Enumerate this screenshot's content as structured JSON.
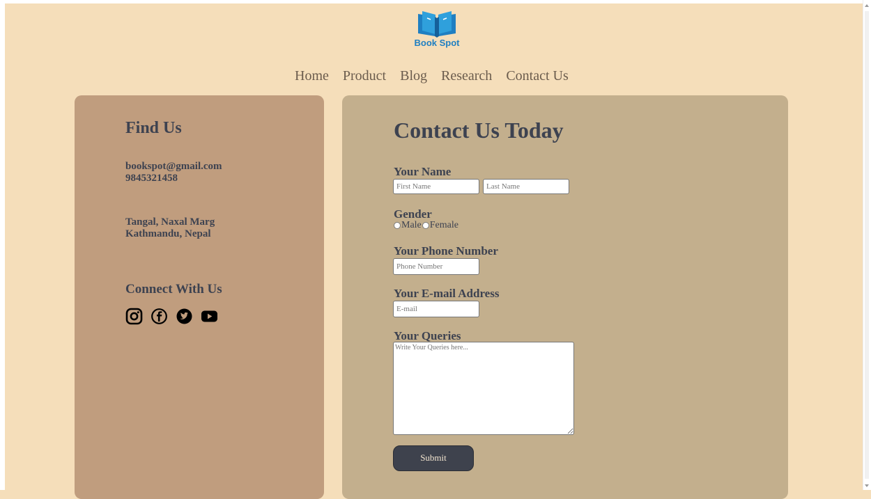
{
  "brand": {
    "name": "Book Spot"
  },
  "nav": {
    "items": [
      "Home",
      "Product",
      "Blog",
      "Research",
      "Contact Us"
    ]
  },
  "find_us": {
    "title": "Find Us",
    "email": "bookspot@gmail.com",
    "phone": "9845321458",
    "address_line1": "Tangal, Naxal Marg",
    "address_line2": "Kathmandu, Nepal",
    "connect_title": "Connect With Us",
    "social_icons": [
      "instagram-icon",
      "facebook-icon",
      "twitter-icon",
      "youtube-icon"
    ]
  },
  "form": {
    "title": "Contact Us Today",
    "name_label": "Your Name",
    "first_name_placeholder": "First Name",
    "last_name_placeholder": "Last Name",
    "gender_label": "Gender",
    "gender_options": [
      "Male",
      "Female"
    ],
    "phone_label": "Your Phone Number",
    "phone_placeholder": "Phone Number",
    "email_label": "Your E-mail Address",
    "email_placeholder": "E-mail",
    "queries_label": "Your Queries",
    "queries_placeholder": "Write Your Queries here...",
    "submit_label": "Submit"
  },
  "colors": {
    "page_background": "#f5deba",
    "left_panel": "#c09d7e",
    "right_panel": "#c3af8d",
    "text": "#3d4250",
    "nav_text": "#6b5c4d",
    "submit_button": "#3e424d",
    "brand_blue": "#1f7fc2"
  }
}
